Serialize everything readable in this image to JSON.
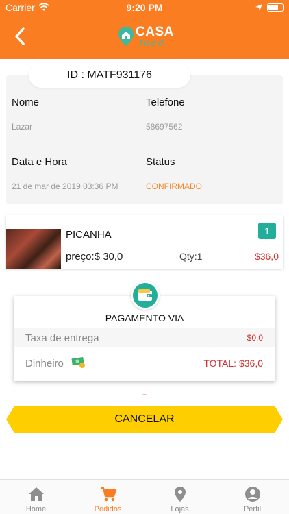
{
  "status_bar": {
    "carrier": "Carrier",
    "time": "9:20 PM"
  },
  "header": {
    "logo_title": "CASA",
    "logo_subtitle": "food"
  },
  "order": {
    "id_label": "ID : MATF931176",
    "fields": {
      "name_label": "Nome",
      "name_value": "Lazar",
      "phone_label": "Telefone",
      "phone_value": "58697562",
      "date_label": "Data e Hora",
      "date_value": "21 de mar de 2019 03:36 PM",
      "status_label": "Status",
      "status_value": "CONFIRMADO"
    }
  },
  "product": {
    "name": "PICANHA",
    "price": "preço:$ 30,0",
    "qty": "Qty:1",
    "total": "$36,0",
    "badge": "1"
  },
  "payment": {
    "title": "PAGAMENTO VIA",
    "delivery_label": "Taxa de entrega",
    "delivery_value": "$0,0",
    "method_label": "Dinheiro",
    "total": "TOTAL: $36,0"
  },
  "cancel_label": "CANCELAR",
  "tabs": [
    {
      "label": "Home",
      "icon": "home-icon"
    },
    {
      "label": "Pedidos",
      "icon": "cart-icon"
    },
    {
      "label": "Lojas",
      "icon": "location-pin-icon"
    },
    {
      "label": "Perfil",
      "icon": "user-icon"
    }
  ],
  "colors": {
    "brand_orange": "#fb7d22",
    "teal": "#23ae9a",
    "cancel_yellow": "#fece00",
    "price_red": "#d0302f",
    "status_orange": "#f3892c"
  }
}
